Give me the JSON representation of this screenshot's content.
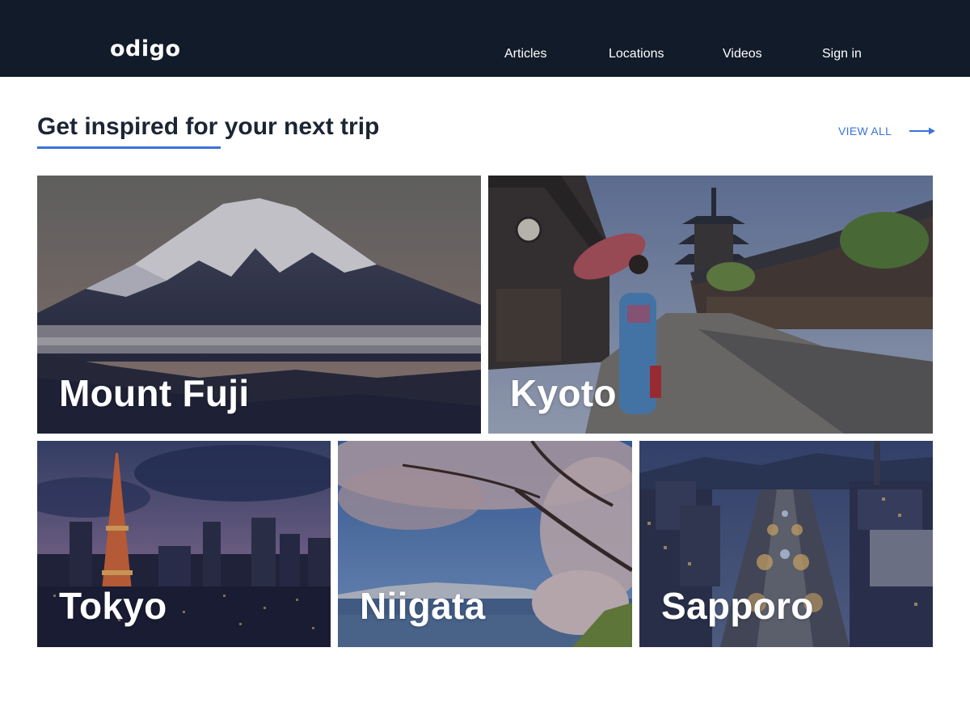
{
  "header": {
    "logo": "odigo",
    "nav": [
      {
        "label": "Articles",
        "icon": null
      },
      {
        "label": "Locations",
        "icon": null
      },
      {
        "label": "Videos",
        "icon": null
      },
      {
        "label": "Sign in",
        "icon": null
      }
    ]
  },
  "section": {
    "title": "Get inspired for your next trip",
    "view_all": "VIEW ALL",
    "view_all_icon": "arrow-right-icon"
  },
  "destinations": [
    {
      "name": "Mount Fuji"
    },
    {
      "name": "Kyoto"
    },
    {
      "name": "Tokyo"
    },
    {
      "name": "Niigata"
    },
    {
      "name": "Sapporo"
    }
  ],
  "colors": {
    "header_bg": "#111b29",
    "accent": "#3b73d9",
    "title_text": "#1b2534"
  }
}
